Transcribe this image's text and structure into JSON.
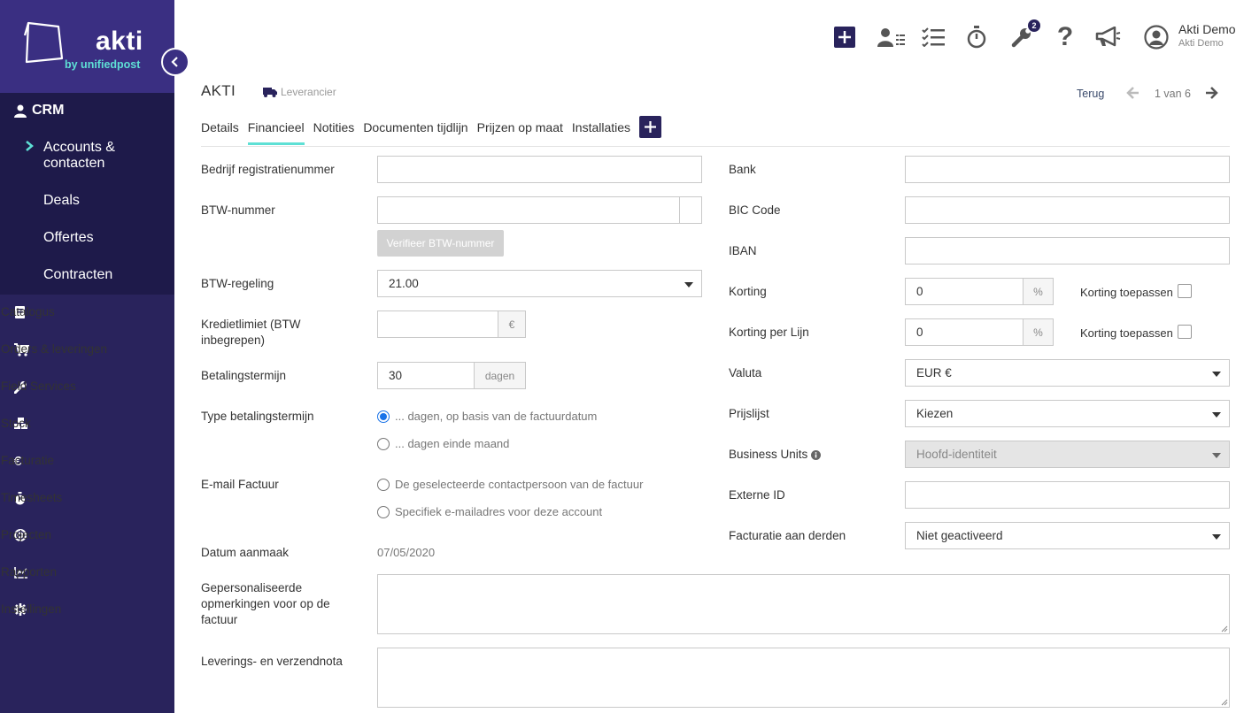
{
  "app": {
    "logo_text": "akti",
    "logo_sub": "by unifiedpost"
  },
  "sidebar": {
    "crm_label": "CRM",
    "crm_sub": [
      "Accounts &",
      "contacten",
      "Deals",
      "Offertes",
      "Contracten"
    ],
    "items": [
      {
        "label": "Catalogus",
        "icon": "book-icon"
      },
      {
        "label": "Orders & leveringen",
        "icon": "cart-icon"
      },
      {
        "label": "Field Services",
        "icon": "wrench-icon"
      },
      {
        "label": "Stock",
        "icon": "cubes-icon"
      },
      {
        "label": "Facturatie",
        "icon": "euro-icon"
      },
      {
        "label": "Timesheets",
        "icon": "stopwatch-icon"
      },
      {
        "label": "Projecten",
        "icon": "target-icon"
      },
      {
        "label": "Rapporten",
        "icon": "chart-icon"
      },
      {
        "label": "Instellingen",
        "icon": "gear-icon"
      }
    ]
  },
  "topbar": {
    "badge_count": "2",
    "user_name": "Akti Demo",
    "user_company": "Akti Demo"
  },
  "header": {
    "title": "AKTI",
    "type_label": "Leverancier",
    "back_label": "Terug",
    "pager": "1 van 6"
  },
  "tabs": [
    "Details",
    "Financieel",
    "Notities",
    "Documenten tijdlijn",
    "Prijzen op maat",
    "Installaties"
  ],
  "form_left": {
    "reg_label": "Bedrijf registratienummer",
    "reg_value": "",
    "vat_label": "BTW-nummer",
    "vat_value": "",
    "verify_button": "Verifieer BTW-nummer",
    "vat_regime_label": "BTW-regeling",
    "vat_regime_value": "21.00",
    "credit_label_1": "Kredietlimiet (BTW",
    "credit_label_2": "inbegrepen)",
    "credit_value": "",
    "credit_addon": "€",
    "term_label": "Betalingstermijn",
    "term_value": "30",
    "term_addon": "dagen",
    "term_type_label": "Type betalingstermijn",
    "term_type_opt1": "... dagen, op basis van de factuurdatum",
    "term_type_opt2": "... dagen einde maand",
    "email_label": "E-mail Factuur",
    "email_opt1": "De geselecteerde contactpersoon van de factuur",
    "email_opt2": "Specifiek e-mailadres voor deze account",
    "created_label": "Datum aanmaak",
    "created_value": "07/05/2020",
    "remarks_label_1": "Gepersonaliseerde",
    "remarks_label_2": "opmerkingen voor op de",
    "remarks_label_3": "factuur",
    "delivery_label": "Leverings- en verzendnota"
  },
  "form_right": {
    "bank_label": "Bank",
    "bank_value": "",
    "bic_label": "BIC Code",
    "bic_value": "",
    "iban_label": "IBAN",
    "iban_value": "",
    "discount_label": "Korting",
    "discount_value": "0",
    "discount_addon": "%",
    "discount_apply_label": "Korting toepassen",
    "line_discount_label": "Korting per Lijn",
    "line_discount_value": "0",
    "line_discount_addon": "%",
    "line_discount_apply_label": "Korting toepassen",
    "currency_label": "Valuta",
    "currency_value": "EUR €",
    "pricelist_label": "Prijslijst",
    "pricelist_value": "Kiezen",
    "bu_label": "Business Units",
    "bu_value": "Hoofd-identiteit",
    "external_label": "Externe ID",
    "external_value": "",
    "third_party_label": "Facturatie aan derden",
    "third_party_value": "Niet geactiveerd"
  },
  "colors": {
    "sidebar_bg": "#29235c",
    "logo_bg": "#3a2f82",
    "accent": "#5ee0d5",
    "radio_checked": "#1a73e8"
  }
}
